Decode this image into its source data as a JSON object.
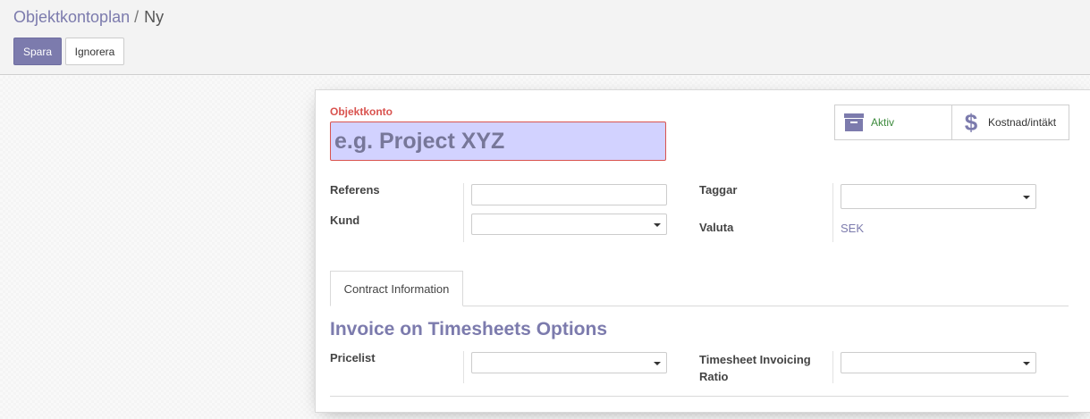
{
  "breadcrumb": {
    "parent": "Objektkontoplan",
    "separator": "/",
    "current": "Ny"
  },
  "toolbar": {
    "save_label": "Spara",
    "discard_label": "Ignorera"
  },
  "form": {
    "name_label": "Objektkonto",
    "name_placeholder": "e.g. Project XYZ",
    "stat_buttons": [
      {
        "label": "Aktiv",
        "icon": "archive-icon"
      },
      {
        "label": "Kostnad/intäkt",
        "icon": "dollar-icon"
      }
    ],
    "fields": {
      "referens_label": "Referens",
      "kund_label": "Kund",
      "taggar_label": "Taggar",
      "valuta_label": "Valuta",
      "valuta_value": "SEK"
    },
    "tabs": [
      {
        "label": "Contract Information"
      }
    ],
    "section_title": "Invoice on Timesheets Options",
    "pricelist_label": "Pricelist",
    "ratio_label_line1": "Timesheet Invoicing",
    "ratio_label_line2": "Ratio"
  },
  "colors": {
    "primary": "#7c7bad",
    "required_label": "#d9534f",
    "required_bg": "#d2d2ff"
  }
}
